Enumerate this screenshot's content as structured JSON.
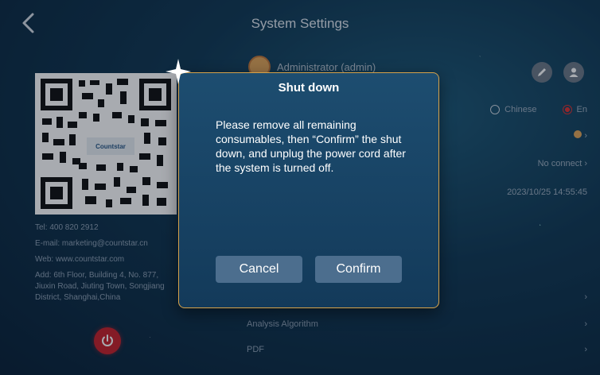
{
  "header": {
    "title": "System Settings",
    "back_icon": "chevron-left-icon"
  },
  "left_panel": {
    "qr_logo_text": "Countstar",
    "tel": "Tel: 400 820 2912",
    "email": "E-mail: marketing@countstar.cn",
    "web": "Web: www.countstar.com",
    "address": "Add: 6th Floor, Building 4, No. 877, Jiuxin Road, Jiuting Town, Songjiang District, Shanghai,China",
    "power_icon": "power-icon",
    "power_color": "#c8232c"
  },
  "account": {
    "user": "Administrator (admin)"
  },
  "right_panel": {
    "edit_icon": "edit-icon",
    "user_icon": "user-icon",
    "language": {
      "option1": "Chinese",
      "option2": "En",
      "selected": "En"
    },
    "connection": "No connect",
    "datetime": "2023/10/25 14:55:45"
  },
  "menu": [
    {
      "label": "Analysis Algorithm"
    },
    {
      "label": "PDF"
    }
  ],
  "dialog": {
    "title": "Shut down",
    "message": "Please remove all remaining consumables, then “Confirm” the shut down, and unplug the power cord after the system is turned off.",
    "cancel_label": "Cancel",
    "confirm_label": "Confirm",
    "border_color": "#d6a24a"
  }
}
